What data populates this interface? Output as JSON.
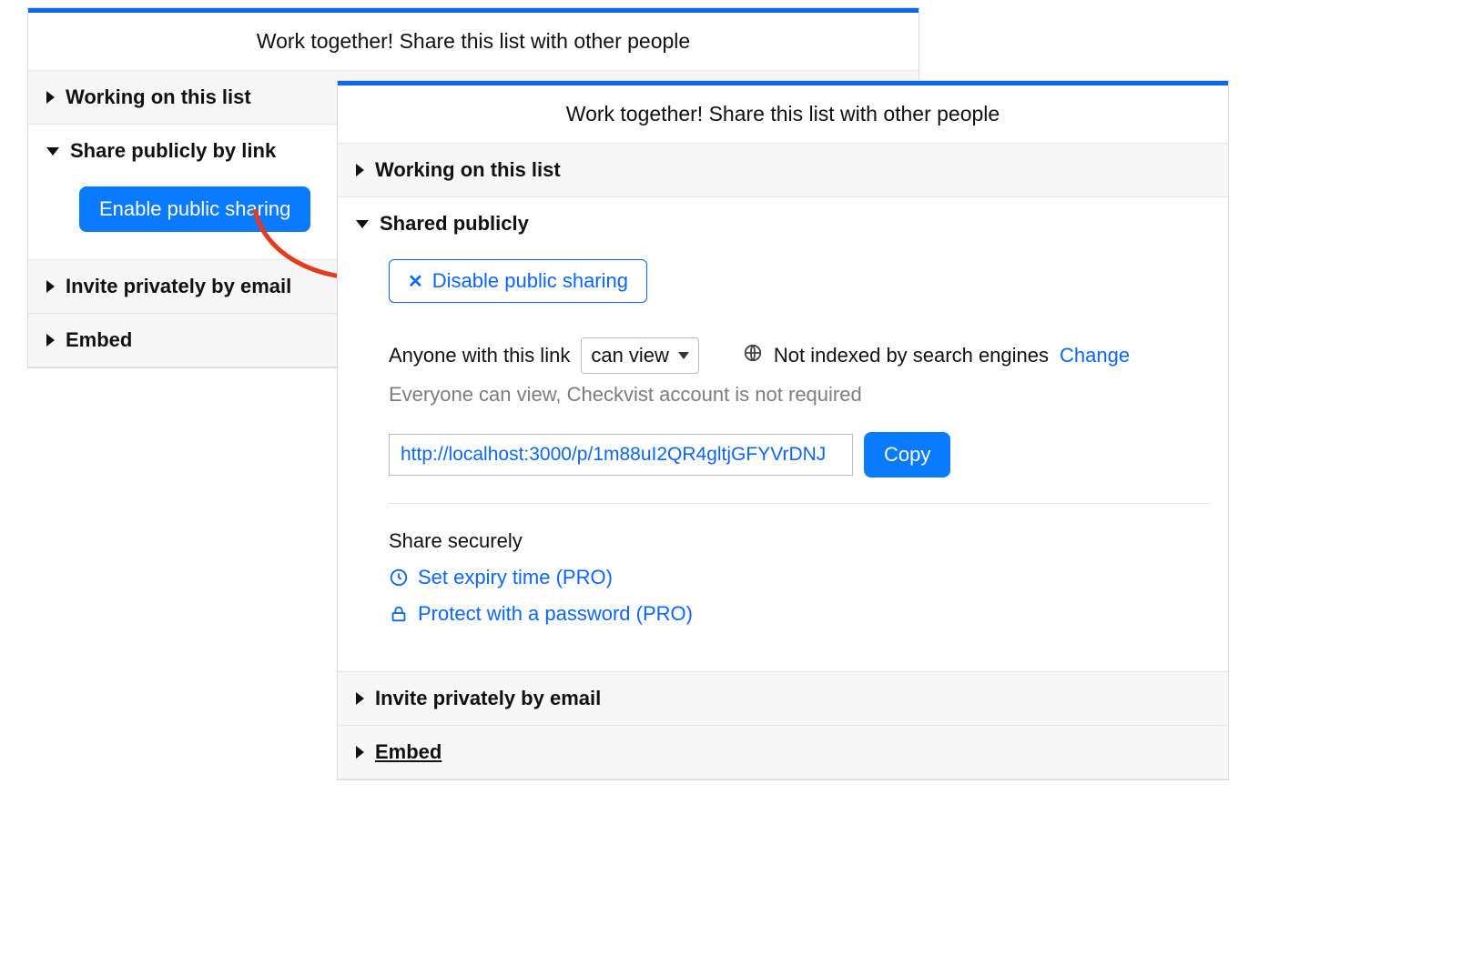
{
  "left": {
    "title": "Work together! Share this list with other people",
    "sections": {
      "working": "Working on this list",
      "share_public": "Share publicly by link",
      "invite": "Invite privately by email",
      "embed": "Embed"
    },
    "enable_button": "Enable public sharing"
  },
  "right": {
    "title": "Work together! Share this list with other people",
    "sections": {
      "working": "Working on this list",
      "shared": "Shared publicly",
      "invite": "Invite privately by email",
      "embed": "Embed"
    },
    "disable_button": "Disable public sharing",
    "anyone_text": "Anyone with this link",
    "permission_selected": "can view",
    "index_text": "Not indexed by search engines",
    "change_link": "Change",
    "help_text": "Everyone can view, Checkvist account is not required",
    "url_value": "http://localhost:3000/p/1m88uI2QR4gltjGFYVrDNJ",
    "copy_button": "Copy",
    "share_securely": "Share securely",
    "expiry_link": "Set expiry time (PRO)",
    "password_link": "Protect with a password (PRO)"
  }
}
